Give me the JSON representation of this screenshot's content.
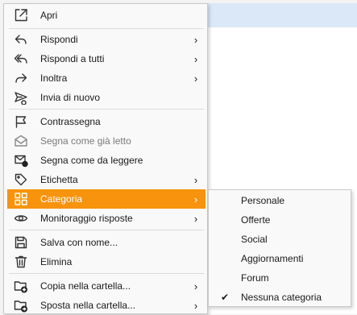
{
  "menu": {
    "items": [
      {
        "label": "Apri",
        "icon": "open-external-icon",
        "submenu": false
      },
      {
        "label": "Rispondi",
        "icon": "reply-icon",
        "submenu": true
      },
      {
        "label": "Rispondi a tutti",
        "icon": "reply-all-icon",
        "submenu": true
      },
      {
        "label": "Inoltra",
        "icon": "forward-icon",
        "submenu": true
      },
      {
        "label": "Invia di nuovo",
        "icon": "resend-icon",
        "submenu": false
      },
      {
        "label": "Contrassegna",
        "icon": "flag-icon",
        "submenu": false
      },
      {
        "label": "Segna come già letto",
        "icon": "mail-read-icon",
        "submenu": false,
        "disabled": true
      },
      {
        "label": "Segna come da leggere",
        "icon": "mail-unread-icon",
        "submenu": false
      },
      {
        "label": "Etichetta",
        "icon": "tag-icon",
        "submenu": true
      },
      {
        "label": "Categoria",
        "icon": "category-grid-icon",
        "submenu": true,
        "active": true
      },
      {
        "label": "Monitoraggio risposte",
        "icon": "eye-icon",
        "submenu": true
      },
      {
        "label": "Salva con nome...",
        "icon": "save-icon",
        "submenu": false
      },
      {
        "label": "Elimina",
        "icon": "trash-icon",
        "submenu": false
      },
      {
        "label": "Copia nella cartella...",
        "icon": "folder-copy-icon",
        "submenu": true
      },
      {
        "label": "Sposta nella cartella...",
        "icon": "folder-move-icon",
        "submenu": true
      }
    ]
  },
  "categoria_submenu": {
    "items": [
      {
        "label": "Personale",
        "checked": false
      },
      {
        "label": "Offerte",
        "checked": false
      },
      {
        "label": "Social",
        "checked": false
      },
      {
        "label": "Aggiornamenti",
        "checked": false
      },
      {
        "label": "Forum",
        "checked": false
      },
      {
        "label": "Nessuna categoria",
        "checked": true
      }
    ],
    "check_glyph": "✔"
  },
  "colors": {
    "accent": "#f7930c",
    "menu_bg": "#f9f9f9",
    "selected_row_bg": "#dbe8f7"
  }
}
